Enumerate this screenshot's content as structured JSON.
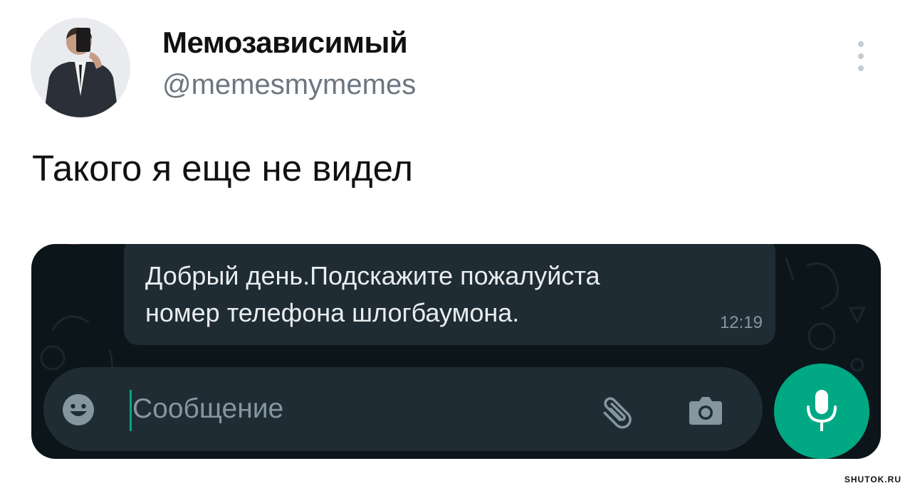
{
  "tweet": {
    "author": {
      "display_name": "Мемозависимый",
      "handle": "@memesmymemes",
      "avatar_icon": "profile-photo"
    },
    "more_icon": "vertical-ellipsis-icon",
    "text": "Такого я еще не видел"
  },
  "chat_screenshot": {
    "message": {
      "line1": "Добрый день.Подскажите пожалуйста",
      "line2": "номер телефона шлогбаумона.",
      "time": "12:19"
    },
    "input": {
      "placeholder": "Сообщение",
      "value": ""
    },
    "icons": {
      "emoji": "emoji-icon",
      "attach": "paperclip-icon",
      "camera": "camera-icon",
      "mic": "microphone-icon"
    },
    "colors": {
      "background": "#0c151a",
      "bubble": "#1f2c33",
      "accent": "#00a884"
    }
  },
  "watermark": "SHUTOK.RU"
}
